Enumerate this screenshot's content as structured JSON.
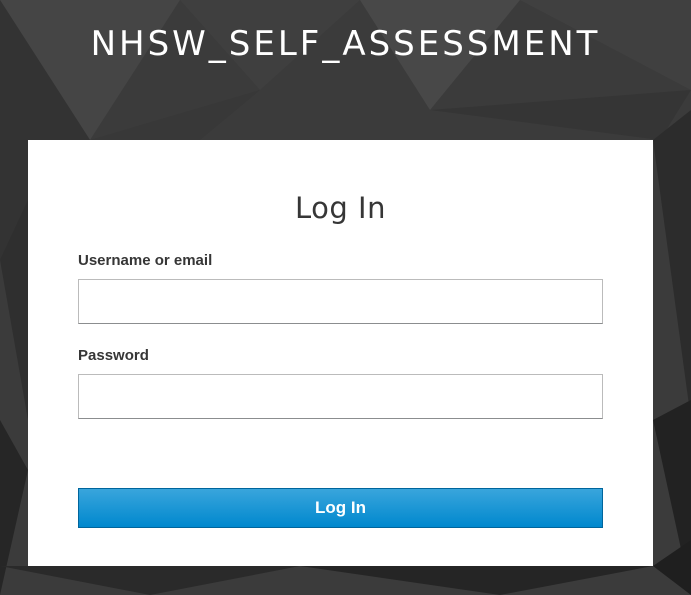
{
  "header": {
    "realm_title": "NHSW_SELF_ASSESSMENT"
  },
  "login_form": {
    "title": "Log In",
    "username_label": "Username or email",
    "username_value": "",
    "password_label": "Password",
    "password_value": "",
    "submit_label": "Log In"
  },
  "colors": {
    "background": "#3a3a3a",
    "card": "#ffffff",
    "button_primary": "#0088ce",
    "button_border": "#00659c"
  }
}
